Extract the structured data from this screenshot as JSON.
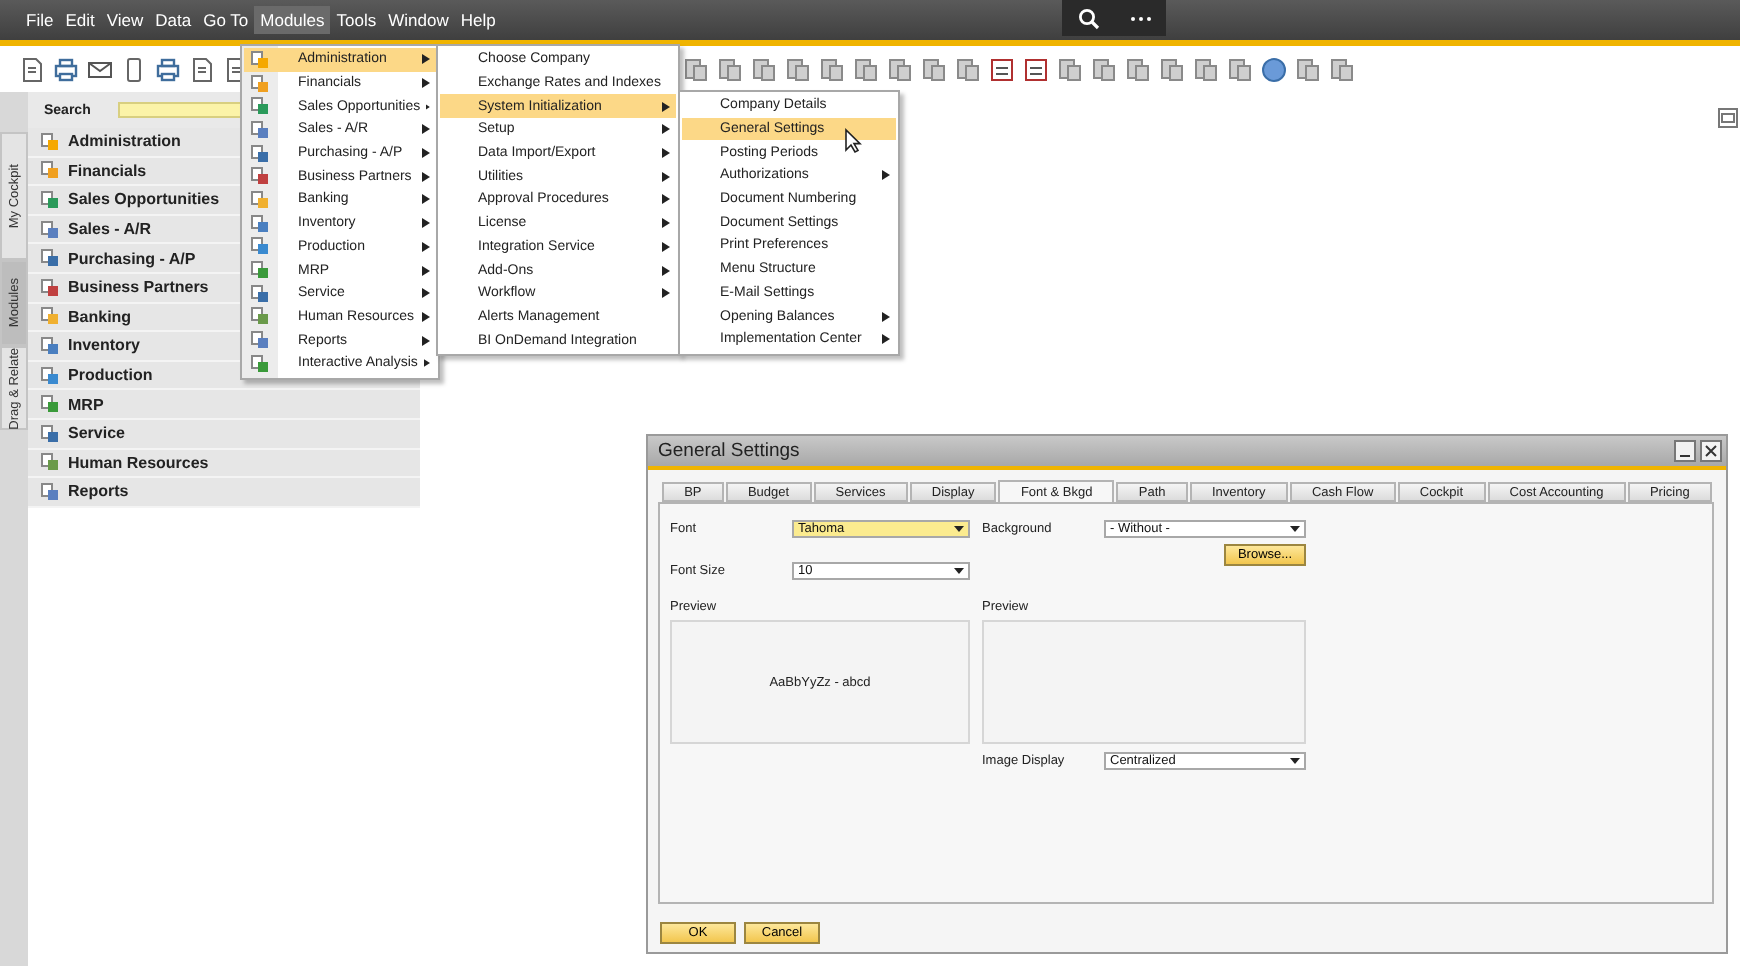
{
  "menu_bar": [
    {
      "label": "File",
      "selected": false
    },
    {
      "label": "Edit",
      "selected": false
    },
    {
      "label": "View",
      "selected": false
    },
    {
      "label": "Data",
      "selected": false
    },
    {
      "label": "Go To",
      "selected": false
    },
    {
      "label": "Modules",
      "selected": true
    },
    {
      "label": "Tools",
      "selected": false
    },
    {
      "label": "Window",
      "selected": false
    },
    {
      "label": "Help",
      "selected": false
    }
  ],
  "sidebar": {
    "tabs": [
      {
        "label": "My Cockpit",
        "selected": false
      },
      {
        "label": "Modules",
        "selected": true
      },
      {
        "label": "Drag & Relate",
        "selected": false
      }
    ],
    "search_label": "Search",
    "items": [
      "Administration",
      "Financials",
      "Sales Opportunities",
      "Sales - A/R",
      "Purchasing - A/P",
      "Business Partners",
      "Banking",
      "Inventory",
      "Production",
      "MRP",
      "Service",
      "Human Resources",
      "Reports"
    ]
  },
  "menus": [
    {
      "items": [
        {
          "label": "Administration",
          "submenu": true,
          "selected": true
        },
        {
          "label": "Financials",
          "submenu": true,
          "selected": false
        },
        {
          "label": "Sales Opportunities",
          "submenu": true,
          "selected": false
        },
        {
          "label": "Sales - A/R",
          "submenu": true,
          "selected": false
        },
        {
          "label": "Purchasing - A/P",
          "submenu": true,
          "selected": false
        },
        {
          "label": "Business Partners",
          "submenu": true,
          "selected": false
        },
        {
          "label": "Banking",
          "submenu": true,
          "selected": false
        },
        {
          "label": "Inventory",
          "submenu": true,
          "selected": false
        },
        {
          "label": "Production",
          "submenu": true,
          "selected": false
        },
        {
          "label": "MRP",
          "submenu": true,
          "selected": false
        },
        {
          "label": "Service",
          "submenu": true,
          "selected": false
        },
        {
          "label": "Human Resources",
          "submenu": true,
          "selected": false
        },
        {
          "label": "Reports",
          "submenu": true,
          "selected": false
        },
        {
          "label": "Interactive Analysis",
          "submenu": true,
          "selected": false
        }
      ]
    },
    {
      "items": [
        {
          "label": "Choose Company",
          "submenu": false,
          "selected": false
        },
        {
          "label": "Exchange Rates and Indexes",
          "submenu": false,
          "selected": false
        },
        {
          "label": "System Initialization",
          "submenu": true,
          "selected": true
        },
        {
          "label": "Setup",
          "submenu": true,
          "selected": false
        },
        {
          "label": "Data Import/Export",
          "submenu": true,
          "selected": false
        },
        {
          "label": "Utilities",
          "submenu": true,
          "selected": false
        },
        {
          "label": "Approval Procedures",
          "submenu": true,
          "selected": false
        },
        {
          "label": "License",
          "submenu": true,
          "selected": false
        },
        {
          "label": "Integration Service",
          "submenu": true,
          "selected": false
        },
        {
          "label": "Add-Ons",
          "submenu": true,
          "selected": false
        },
        {
          "label": "Workflow",
          "submenu": true,
          "selected": false
        },
        {
          "label": "Alerts Management",
          "submenu": false,
          "selected": false
        },
        {
          "label": "BI OnDemand Integration",
          "submenu": false,
          "selected": false
        }
      ]
    },
    {
      "items": [
        {
          "label": "Company Details",
          "submenu": false,
          "selected": false
        },
        {
          "label": "General Settings",
          "submenu": false,
          "selected": true
        },
        {
          "label": "Posting Periods",
          "submenu": false,
          "selected": false
        },
        {
          "label": "Authorizations",
          "submenu": true,
          "selected": false
        },
        {
          "label": "Document Numbering",
          "submenu": false,
          "selected": false
        },
        {
          "label": "Document Settings",
          "submenu": false,
          "selected": false
        },
        {
          "label": "Print Preferences",
          "submenu": false,
          "selected": false
        },
        {
          "label": "Menu Structure",
          "submenu": false,
          "selected": false
        },
        {
          "label": "E-Mail Settings",
          "submenu": false,
          "selected": false
        },
        {
          "label": "Opening Balances",
          "submenu": true,
          "selected": false
        },
        {
          "label": "Implementation Center",
          "submenu": true,
          "selected": false
        }
      ]
    }
  ],
  "dialog": {
    "title": "General Settings",
    "tabs": [
      {
        "label": "BP",
        "selected": false
      },
      {
        "label": "Budget",
        "selected": false
      },
      {
        "label": "Services",
        "selected": false
      },
      {
        "label": "Display",
        "selected": false
      },
      {
        "label": "Font & Bkgd",
        "selected": true
      },
      {
        "label": "Path",
        "selected": false
      },
      {
        "label": "Inventory",
        "selected": false
      },
      {
        "label": "Cash Flow",
        "selected": false
      },
      {
        "label": "Cockpit",
        "selected": false
      },
      {
        "label": "Cost Accounting",
        "selected": false
      },
      {
        "label": "Pricing",
        "selected": false
      }
    ],
    "font": {
      "label": "Font",
      "value": "Tahoma",
      "highlighted": true
    },
    "font_size": {
      "label": "Font Size",
      "value": "10",
      "highlighted": false
    },
    "background": {
      "label": "Background",
      "value": "- Without -",
      "highlighted": false
    },
    "browse_button": "Browse...",
    "preview_font": {
      "label": "Preview",
      "text": "AaBbYyZz - abcd"
    },
    "preview_image": {
      "label": "Preview"
    },
    "image_display": {
      "label": "Image Display",
      "value": "Centralized",
      "highlighted": false
    },
    "buttons": [
      "OK",
      "Cancel"
    ]
  }
}
